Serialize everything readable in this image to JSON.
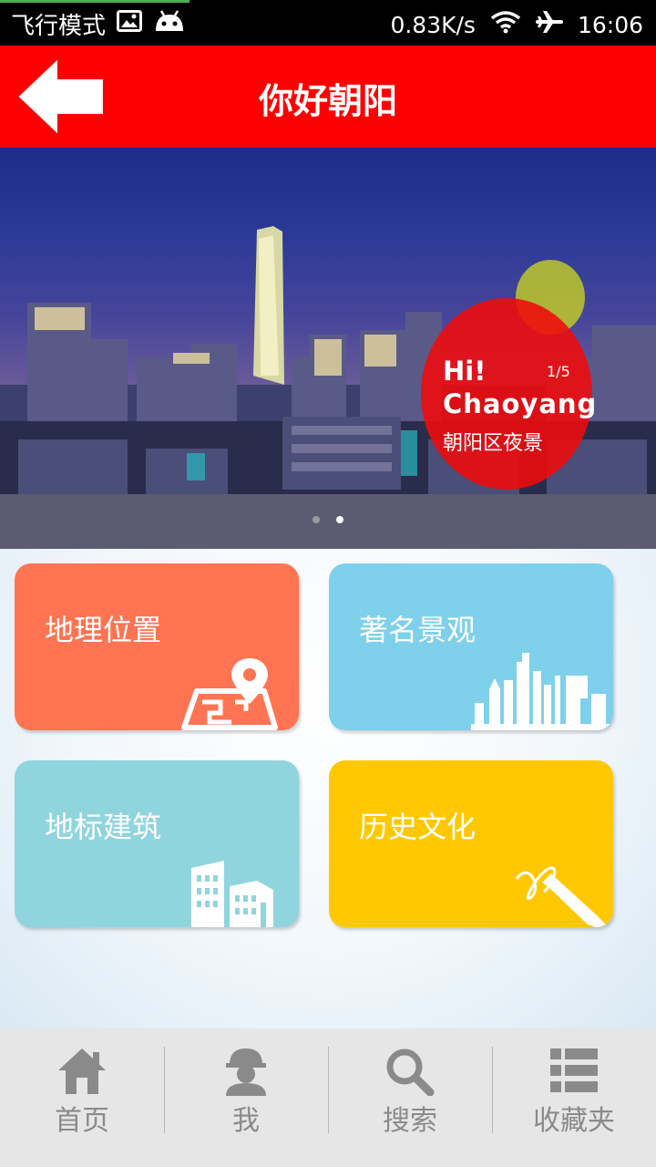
{
  "status_bar": {
    "mode": "飞行模式",
    "speed": "0.83K/s",
    "time": "16:06",
    "icons": [
      "image-icon",
      "android-icon",
      "wifi-icon",
      "airplane-icon"
    ]
  },
  "header": {
    "title": "你好朝阳",
    "back_icon": "back-arrow-icon",
    "color": "#ff0000"
  },
  "banner": {
    "line1": "Hi!",
    "line2": "Chaoyang",
    "line3": "朝阳区夜景",
    "page": "1/5",
    "dots": 2,
    "active_dot": 1
  },
  "tiles": [
    {
      "label": "地理位置",
      "icon": "map-pin-icon",
      "color": "#ff7452"
    },
    {
      "label": "著名景观",
      "icon": "skyline-icon",
      "color": "#7fd0ea"
    },
    {
      "label": "地标建筑",
      "icon": "buildings-icon",
      "color": "#90d4dd"
    },
    {
      "label": "历史文化",
      "icon": "brush-icon",
      "color": "#ffc800"
    }
  ],
  "nav": [
    {
      "label": "首页",
      "icon": "home-icon"
    },
    {
      "label": "我",
      "icon": "user-icon"
    },
    {
      "label": "搜索",
      "icon": "search-icon"
    },
    {
      "label": "收藏夹",
      "icon": "list-icon"
    }
  ]
}
